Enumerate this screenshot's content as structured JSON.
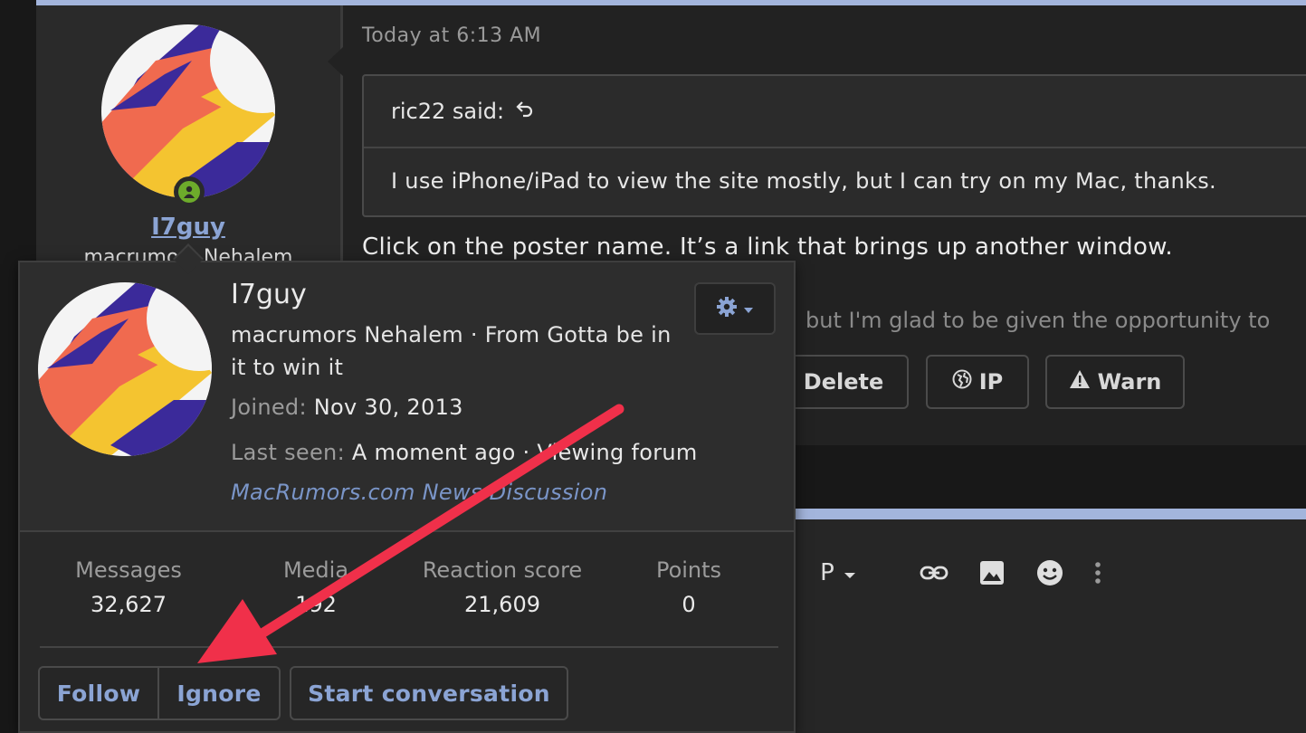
{
  "post": {
    "timestamp": "Today at 6:13 AM",
    "author": "I7guy",
    "author_title": "macrumors Nehalem",
    "quote": {
      "header": "ric22 said:",
      "header_icon": "quote-return-arrow-icon",
      "body": "I use iPhone/iPad to view the site mostly, but I can try on my Mac, thanks."
    },
    "reply_text": "Click on the poster name. It’s a link that brings up another window.",
    "next_post_snippet": "but I'm glad to be given the opportunity to",
    "actions": {
      "delete": "Delete",
      "ip": "IP",
      "warn": "Warn"
    }
  },
  "editor": {
    "paragraph_label": "P",
    "icons": [
      "link-icon",
      "image-icon",
      "emoji-icon",
      "more-vertical-icon"
    ]
  },
  "member_card": {
    "username": "I7guy",
    "title_line": "macrumors Nehalem · From Gotta be in it to win it",
    "joined_label": "Joined:",
    "joined_value": "Nov 30, 2013",
    "last_seen_label": "Last seen:",
    "last_seen_value": "A moment ago · Viewing forum",
    "last_seen_link": "MacRumors.com News Discussion",
    "stats": {
      "messages_label": "Messages",
      "messages_value": "32,627",
      "media_label": "Media",
      "media_value": "192",
      "reaction_label": "Reaction score",
      "reaction_value": "21,609",
      "points_label": "Points",
      "points_value": "0"
    },
    "buttons": {
      "follow": "Follow",
      "ignore": "Ignore",
      "start_conversation": "Start conversation"
    }
  },
  "colors": {
    "accent_blue": "#a3b5dc",
    "link_blue": "#8ba4d4",
    "online_green": "#6dab2b",
    "annotation_red": "#f0304a"
  }
}
